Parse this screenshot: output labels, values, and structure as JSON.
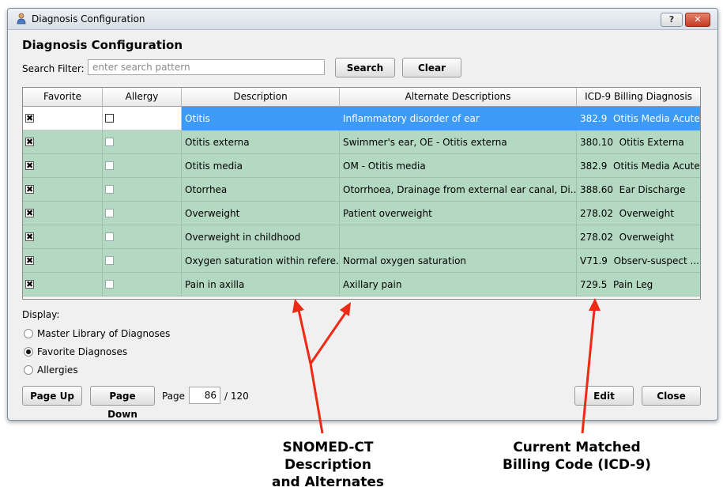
{
  "window": {
    "title": "Diagnosis Configuration",
    "help_label": "?",
    "close_label": "✕"
  },
  "heading": "Diagnosis Configuration",
  "filter": {
    "label": "Search Filter:",
    "placeholder": "enter search pattern",
    "value": ""
  },
  "buttons": {
    "search": "Search",
    "clear": "Clear",
    "page_up": "Page Up",
    "page_down": "Page Down",
    "edit": "Edit",
    "close": "Close"
  },
  "columns": [
    "Favorite",
    "Allergy",
    "Description",
    "Alternate Descriptions",
    "ICD-9 Billing Diagnosis"
  ],
  "rows": [
    {
      "favorite": true,
      "allergy": false,
      "description": "Otitis",
      "alternate": "Inflammatory disorder of ear",
      "code": "382.9",
      "billing": "Otitis Media Acute",
      "selected": true
    },
    {
      "favorite": true,
      "allergy": false,
      "description": "Otitis externa",
      "alternate": "Swimmer's ear, OE - Otitis externa",
      "code": "380.10",
      "billing": "Otitis Externa",
      "selected": false
    },
    {
      "favorite": true,
      "allergy": false,
      "description": "Otitis media",
      "alternate": "OM - Otitis media",
      "code": "382.9",
      "billing": "Otitis Media Acute",
      "selected": false
    },
    {
      "favorite": true,
      "allergy": false,
      "description": "Otorrhea",
      "alternate": "Otorrhoea, Drainage from external ear canal, Di...",
      "code": "388.60",
      "billing": "Ear Discharge",
      "selected": false
    },
    {
      "favorite": true,
      "allergy": false,
      "description": "Overweight",
      "alternate": "Patient overweight",
      "code": "278.02",
      "billing": "Overweight",
      "selected": false
    },
    {
      "favorite": true,
      "allergy": false,
      "description": "Overweight in childhood",
      "alternate": "",
      "code": "278.02",
      "billing": "Overweight",
      "selected": false
    },
    {
      "favorite": true,
      "allergy": false,
      "description": "Oxygen saturation within refere...",
      "alternate": "Normal oxygen saturation",
      "code": "V71.9",
      "billing": "Observ-suspect ...",
      "selected": false
    },
    {
      "favorite": true,
      "allergy": false,
      "description": "Pain in axilla",
      "alternate": "Axillary pain",
      "code": "729.5",
      "billing": "Pain Leg",
      "selected": false
    }
  ],
  "display": {
    "label": "Display:",
    "options": [
      {
        "label": "Master Library of Diagnoses",
        "selected": false
      },
      {
        "label": "Favorite Diagnoses",
        "selected": true
      },
      {
        "label": "Allergies",
        "selected": false
      }
    ]
  },
  "paging": {
    "label": "Page",
    "current": "86",
    "total": "/ 120"
  },
  "annotations": {
    "snomed_line1": "SNOMED-CT Description",
    "snomed_line2": "and Alternates",
    "billing_line1": "Current Matched",
    "billing_line2": "Billing Code (ICD-9)"
  },
  "colors": {
    "row_bg": "#b4d9c2",
    "selected_bg": "#3d9af5",
    "arrow": "#ee2a14"
  },
  "icons": {
    "app": "person-icon",
    "checkmark": "x-checkbox-icon"
  }
}
